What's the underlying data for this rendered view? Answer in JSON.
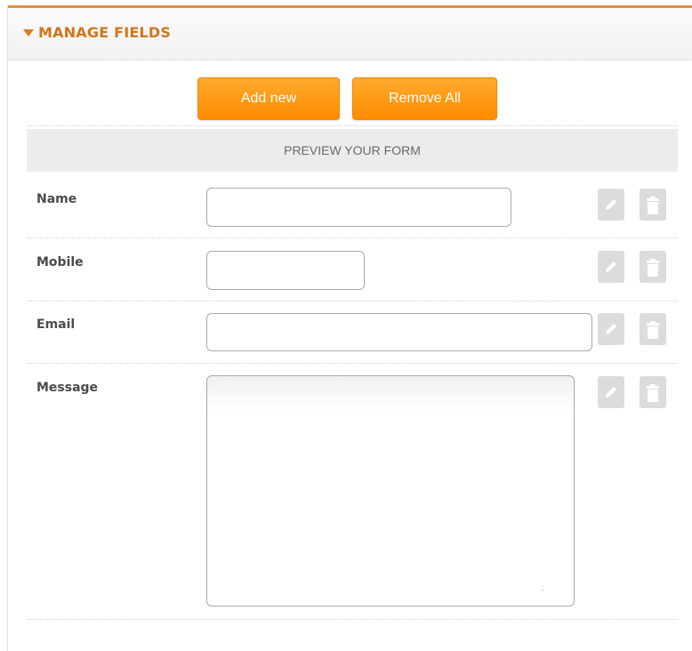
{
  "panel": {
    "title": "MANAGE FIELDS"
  },
  "toolbar": {
    "add_label": "Add new",
    "remove_label": "Remove All"
  },
  "preview": {
    "heading": "PREVIEW YOUR FORM"
  },
  "fields": [
    {
      "label": "Name",
      "type": "text",
      "value": ""
    },
    {
      "label": "Mobile",
      "type": "text",
      "value": ""
    },
    {
      "label": "Email",
      "type": "text",
      "value": ""
    },
    {
      "label": "Message",
      "type": "textarea",
      "value": ""
    }
  ],
  "icons": {
    "edit": "pencil-icon",
    "delete": "trash-icon"
  },
  "colors": {
    "accent": "#ff9a10",
    "header_text": "#d4751d",
    "header_border": "#e8913a",
    "icon_bg": "#dcdcdc"
  }
}
